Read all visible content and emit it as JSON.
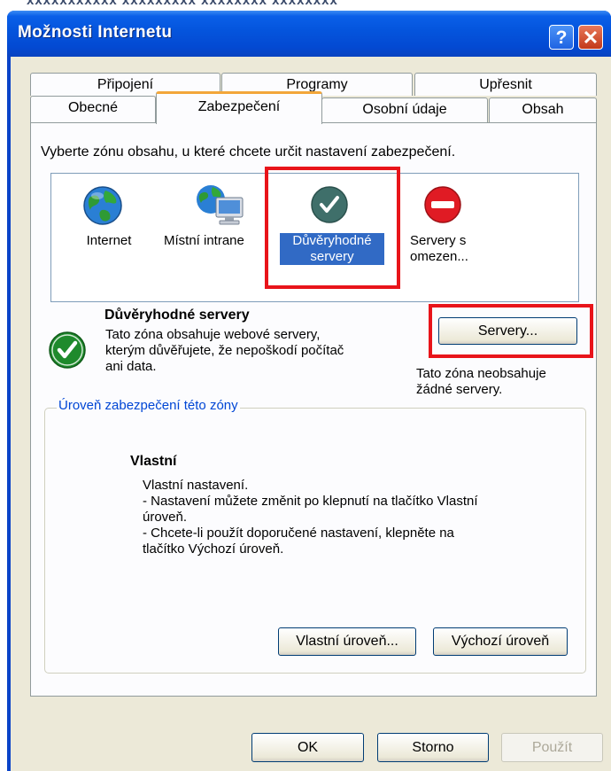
{
  "window": {
    "behind_text": "xxxxxxxxxxx    xxxxxxxxx xxxxxxxx xxxxxxxx",
    "title": "Možnosti Internetu",
    "help_label": "?",
    "close_label": "✕"
  },
  "tabs_row1": [
    "Připojení",
    "Programy",
    "Upřesnit"
  ],
  "tabs_row2": [
    "Obecné",
    "Zabezpečení",
    "Osobní údaje",
    "Obsah"
  ],
  "selected_tab": "Zabezpečení",
  "instruction": "Vyberte zónu obsahu, u které chcete určit nastavení zabezpečení.",
  "zones": {
    "internet": "Internet",
    "intranet": "Místní intrane",
    "trusted_line1": "Důvěryhodné",
    "trusted_line2": "servery",
    "restricted_line1": "Servery s",
    "restricted_line2": "omezen..."
  },
  "zone_info": {
    "title": "Důvěryhodné servery",
    "desc_line1": "Tato zóna obsahuje webové servery,",
    "desc_line2": "kterým důvěřujete, že nepoškodí počítač",
    "desc_line3": "ani data.",
    "servers_button": "Servery...",
    "no_servers_line1": "Tato zóna neobsahuje",
    "no_servers_line2": "žádné servery."
  },
  "level_group": {
    "legend": "Úroveň zabezpečení této zóny",
    "name": "Vlastní",
    "line1": "Vlastní nastavení.",
    "line2": "- Nastavení můžete změnit po klepnutí na tlačítko Vlastní",
    "line3": "úroveň.",
    "line4": "- Chcete-li použít doporučené nastavení, klepněte na",
    "line5": "tlačítko Výchozí úroveň.",
    "custom_button": "Vlastní úroveň...",
    "default_button": "Výchozí úroveň"
  },
  "footer": {
    "ok": "OK",
    "cancel": "Storno",
    "apply": "Použít"
  },
  "colors": {
    "titlebar": "#0454dc",
    "highlight": "#e8141a",
    "selection": "#316ac5",
    "tab_accent": "#f2a63a"
  },
  "icons": {
    "internet": "globe-icon",
    "intranet": "globe-computer-icon",
    "trusted": "checkmark-icon",
    "restricted": "no-entry-icon"
  }
}
